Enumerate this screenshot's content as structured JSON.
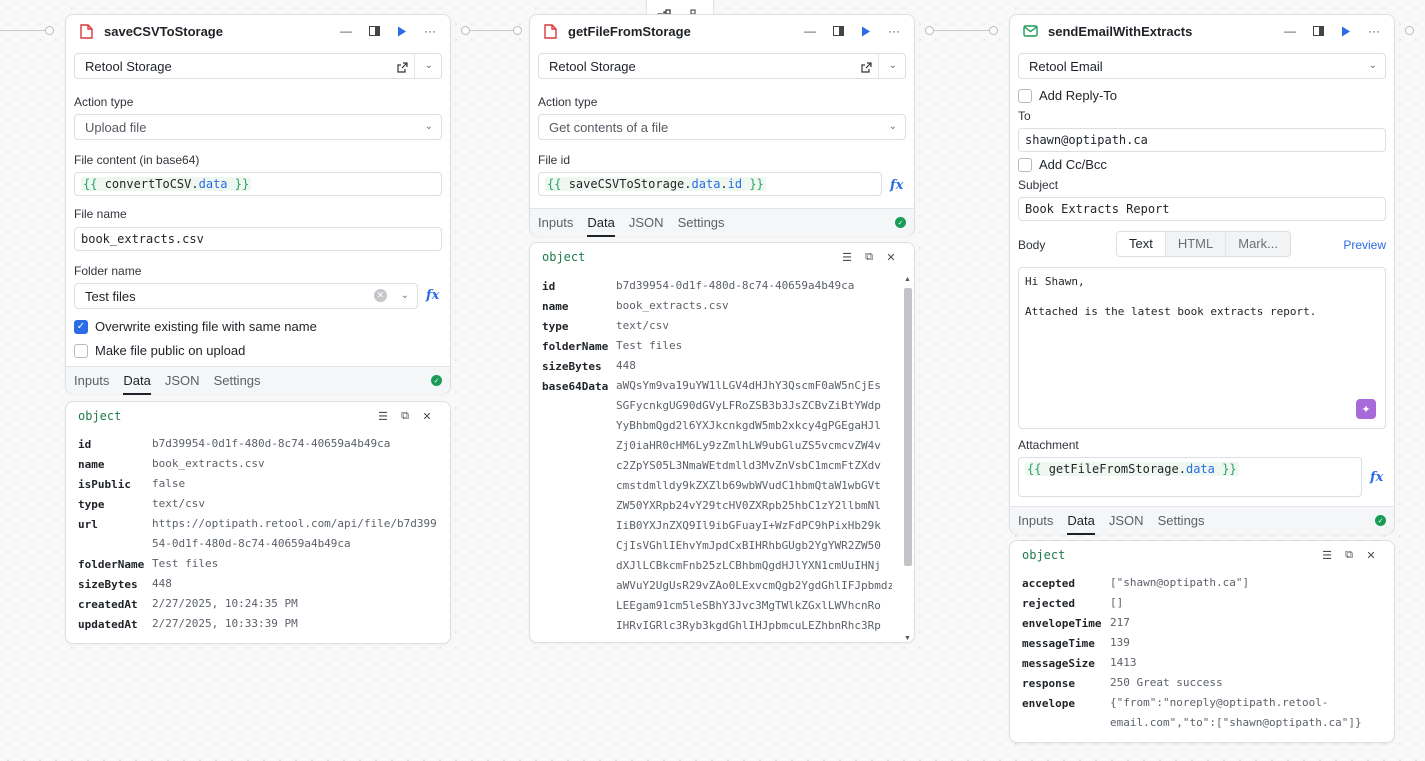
{
  "canvas": {
    "toolbar_icons": [
      "workflow-icon",
      "tree-icon"
    ]
  },
  "save_block": {
    "title": "saveCSVToStorage",
    "resource": "Retool Storage",
    "action_type_label": "Action type",
    "action_type": "Upload file",
    "file_content_label": "File content (in base64)",
    "file_content_ident": "convertToCSV",
    "file_content_prop": "data",
    "file_name_label": "File name",
    "file_name": "book_extracts.csv",
    "folder_name_label": "Folder name",
    "folder_name": "Test files",
    "overwrite_label": "Overwrite existing file with same name",
    "overwrite_checked": true,
    "public_label": "Make file public on upload",
    "public_checked": false,
    "tabs": [
      "Inputs",
      "Data",
      "JSON",
      "Settings"
    ],
    "active_tab": "Data",
    "result": {
      "title": "object",
      "rows": [
        {
          "k": "id",
          "v": "b7d39954-0d1f-480d-8c74-40659a4b49ca"
        },
        {
          "k": "name",
          "v": "book_extracts.csv"
        },
        {
          "k": "isPublic",
          "v": "false"
        },
        {
          "k": "type",
          "v": "text/csv"
        },
        {
          "k": "url",
          "v": "https://optipath.retool.com/api/file/b7d399\n54-0d1f-480d-8c74-40659a4b49ca"
        },
        {
          "k": "folderName",
          "v": "Test files"
        },
        {
          "k": "sizeBytes",
          "v": "448"
        },
        {
          "k": "createdAt",
          "v": "2/27/2025, 10:24:35 PM"
        },
        {
          "k": "updatedAt",
          "v": "2/27/2025, 10:33:39 PM"
        }
      ]
    }
  },
  "get_block": {
    "title": "getFileFromStorage",
    "resource": "Retool Storage",
    "action_type_label": "Action type",
    "action_type": "Get contents of a file",
    "file_id_label": "File id",
    "file_id_ident": "saveCSVToStorage",
    "file_id_prop1": "data",
    "file_id_prop2": "id",
    "tabs": [
      "Inputs",
      "Data",
      "JSON",
      "Settings"
    ],
    "active_tab": "Data",
    "result": {
      "title": "object",
      "rows": [
        {
          "k": "id",
          "v": "b7d39954-0d1f-480d-8c74-40659a4b49ca"
        },
        {
          "k": "name",
          "v": "book_extracts.csv"
        },
        {
          "k": "type",
          "v": "text/csv"
        },
        {
          "k": "folderName",
          "v": "Test files"
        },
        {
          "k": "sizeBytes",
          "v": "448"
        },
        {
          "k": "base64Data",
          "v": "aWQsYm9va19uYW1lLGV4dHJhY3QscmF0aW5nCjEs\nSGFycnkgUG90dGVyLFRoZSB3b3JsZCBvZiBtYWdp\nYyBhbmQgd2l6YXJkcnkgdW5mb2xkcy4gPGEgaHJl\nZj0iaHR0cHM6Ly9zZmlhLW9ubGluZS5vcmcvZW4v\nc2ZpYS05L3NmaWEtdmlld3MvZnVsbC1mcmFtZXdv\ncmstdmlldy9kZXZlb69wbWVudC1hbmQtaW1wbGVt\nZW50YXRpb24vY29tcHV0ZXRpb25hbC1zY2llbmNl\nIiB0YXJnZXQ9Il9ibGFuayI+WzFdPC9hPixHb29k\nCjIsVGhlIEhvYmJpdCxBIHRhbGUgb2YgYWR2ZW50\ndXJlLCBkcmFnb25zLCBhbmQgdHJlYXN1cmUuIHNj\naWVuY2UgUsR29vZAo0LExvcmQgb2YgdGhlIFJpbmdz\nLEEgam91cm5leSBhY3Jvc3MgTWlkZGxlLWVhcnRo\nIHRvIGRlc3Ryb3kgdGhlIHJpbmcuLEZhbnRhc3Rp\nYy..."
        }
      ]
    }
  },
  "email_block": {
    "title": "sendEmailWithExtracts",
    "resource": "Retool Email",
    "reply_to_label": "Add Reply-To",
    "to_label": "To",
    "to_value": "shawn@optipath.ca",
    "cc_label": "Add Cc/Bcc",
    "subject_label": "Subject",
    "subject_value": "Book Extracts Report",
    "body_label": "Body",
    "body_modes": [
      "Text",
      "HTML",
      "Mark..."
    ],
    "active_mode": "Text",
    "preview_label": "Preview",
    "body_value": "Hi Shawn,\n\nAttached is the latest book extracts report.",
    "attachment_label": "Attachment",
    "attachment_ident": "getFileFromStorage",
    "attachment_prop": "data",
    "tabs": [
      "Inputs",
      "Data",
      "JSON",
      "Settings"
    ],
    "active_tab": "Data",
    "result": {
      "title": "object",
      "rows": [
        {
          "k": "accepted",
          "v": "[\"shawn@optipath.ca\"]"
        },
        {
          "k": "rejected",
          "v": "[]"
        },
        {
          "k": "envelopeTime",
          "v": "217"
        },
        {
          "k": "messageTime",
          "v": "139"
        },
        {
          "k": "messageSize",
          "v": "1413"
        },
        {
          "k": "response",
          "v": "250 Great success"
        },
        {
          "k": "envelope",
          "v": "{\"from\":\"noreply@optipath.retool-\nemail.com\",\"to\":[\"shawn@optipath.ca\"]}"
        }
      ]
    }
  },
  "colors": {
    "accent": "#2b6be6",
    "success": "#1a9c56",
    "code_green": "#1f7a4d",
    "storage_icon": "#d9383a",
    "email_icon": "#1a9c56"
  }
}
